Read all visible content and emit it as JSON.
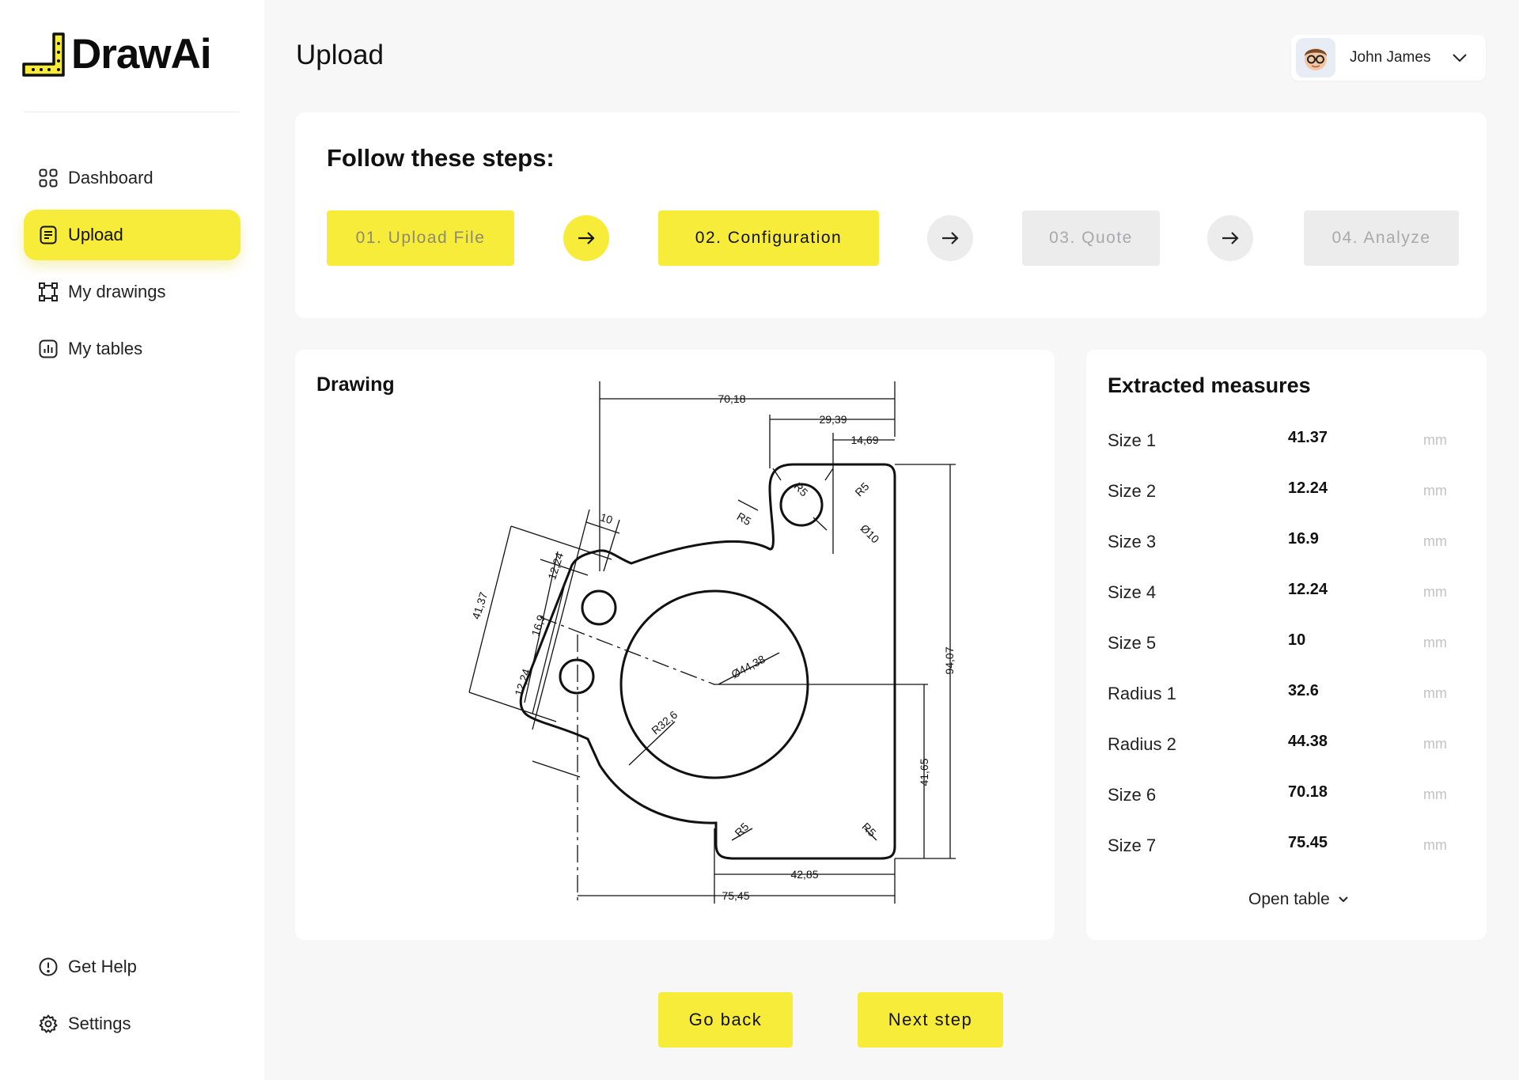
{
  "app": {
    "logo_text": "DrawAi"
  },
  "colors": {
    "accent": "#f8ec3b",
    "muted": "#ececec",
    "background": "#f7f7f8"
  },
  "sidebar": {
    "items": [
      {
        "label": "Dashboard",
        "icon": "grid-icon"
      },
      {
        "label": "Upload",
        "icon": "document-icon",
        "active": true
      },
      {
        "label": "My drawings",
        "icon": "vector-square-icon"
      },
      {
        "label": "My tables",
        "icon": "chart-icon"
      }
    ],
    "bottom_items": [
      {
        "label": "Get Help",
        "icon": "info-circle-icon"
      },
      {
        "label": "Settings",
        "icon": "gear-icon"
      }
    ]
  },
  "header": {
    "title": "Upload",
    "user_name": "John James"
  },
  "steps": {
    "title": "Follow these steps:",
    "items": [
      {
        "label": "01. Upload File",
        "state": "done"
      },
      {
        "label": "02. Configuration",
        "state": "current"
      },
      {
        "label": "03. Quote",
        "state": "todo"
      },
      {
        "label": "04. Analyze",
        "state": "todo"
      }
    ]
  },
  "drawing": {
    "label": "Drawing",
    "dimensions": [
      "70,18",
      "29,39",
      "14,69",
      "10",
      "12,24",
      "41,37",
      "16,9",
      "12,24",
      "Ø44,38",
      "R32,6",
      "Ø10",
      "R5",
      "R5",
      "R5",
      "R5",
      "R5",
      "94,07",
      "41,65",
      "42,85",
      "75,45"
    ]
  },
  "measures": {
    "title": "Extracted measures",
    "rows": [
      {
        "name": "Size 1",
        "value": "41.37",
        "unit": "mm"
      },
      {
        "name": "Size 2",
        "value": "12.24",
        "unit": "mm"
      },
      {
        "name": "Size 3",
        "value": "16.9",
        "unit": "mm"
      },
      {
        "name": "Size 4",
        "value": "12.24",
        "unit": "mm"
      },
      {
        "name": "Size 5",
        "value": "10",
        "unit": "mm"
      },
      {
        "name": "Radius 1",
        "value": "32.6",
        "unit": "mm"
      },
      {
        "name": "Radius 2",
        "value": "44.38",
        "unit": "mm"
      },
      {
        "name": "Size 6",
        "value": "70.18",
        "unit": "mm"
      },
      {
        "name": "Size 7",
        "value": "75.45",
        "unit": "mm"
      }
    ],
    "open_table_label": "Open table"
  },
  "footer": {
    "back_label": "Go back",
    "next_label": "Next step"
  }
}
